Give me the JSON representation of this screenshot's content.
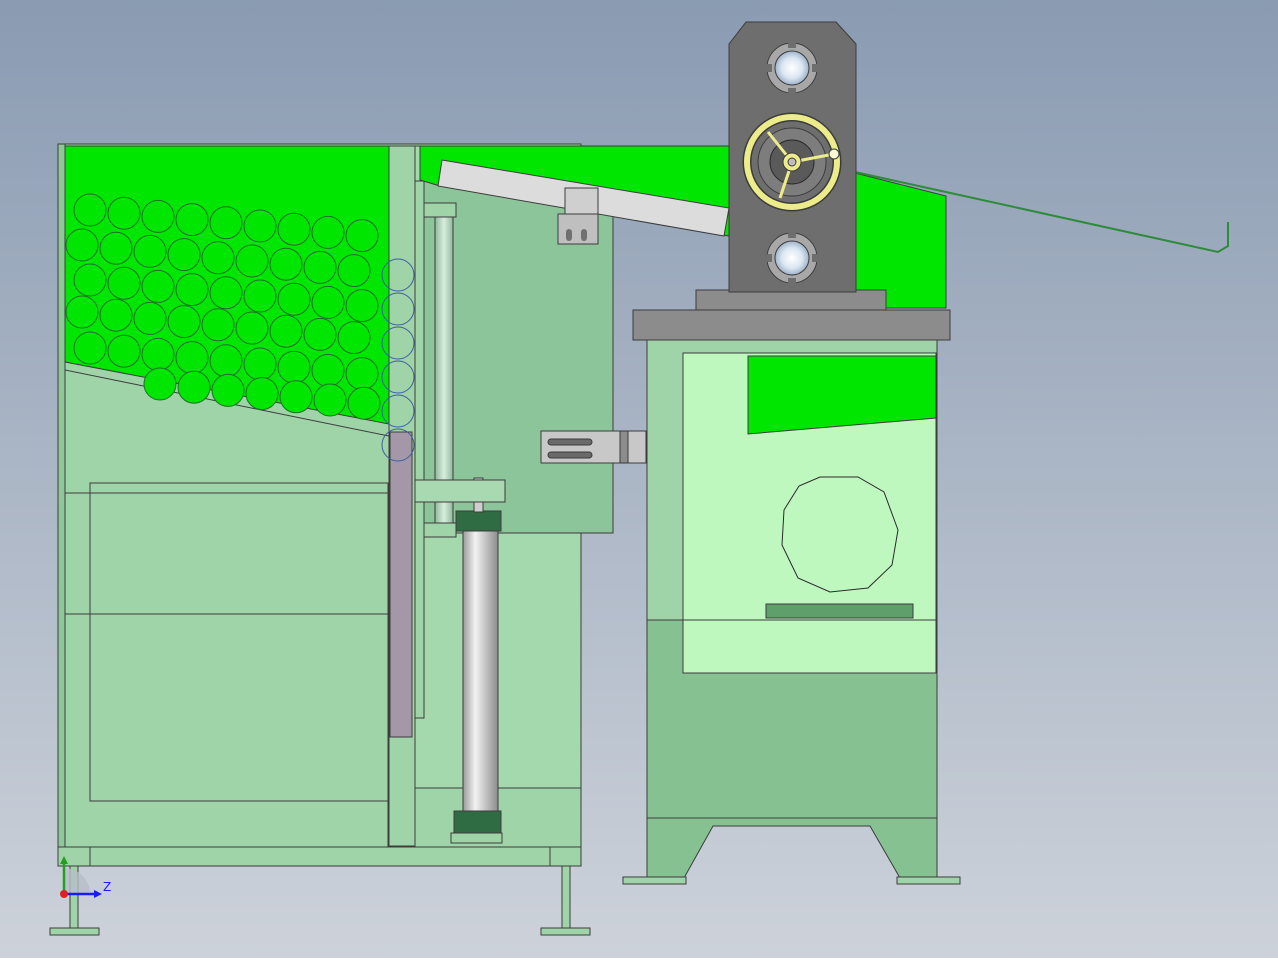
{
  "view": {
    "background_top": "#8a9bb2",
    "background_bottom": "#cdd2da"
  },
  "colors": {
    "bright_green": "#00e600",
    "panel_green": "#9fd3a8",
    "panel_green_dark": "#86c291",
    "panel_green_light": "#bff8bf",
    "frame_gray": "#6e6e6e",
    "edge_gray": "#3c3c3c",
    "wheel_yellow": "#ecec8a",
    "purple_plate": "#a497a8",
    "cylinder_dark": "#2f6b43"
  },
  "icons": {
    "handwheel": "handwheel-icon",
    "triad": "coordinate-triad-icon"
  },
  "triad": {
    "z_label": "Z"
  }
}
